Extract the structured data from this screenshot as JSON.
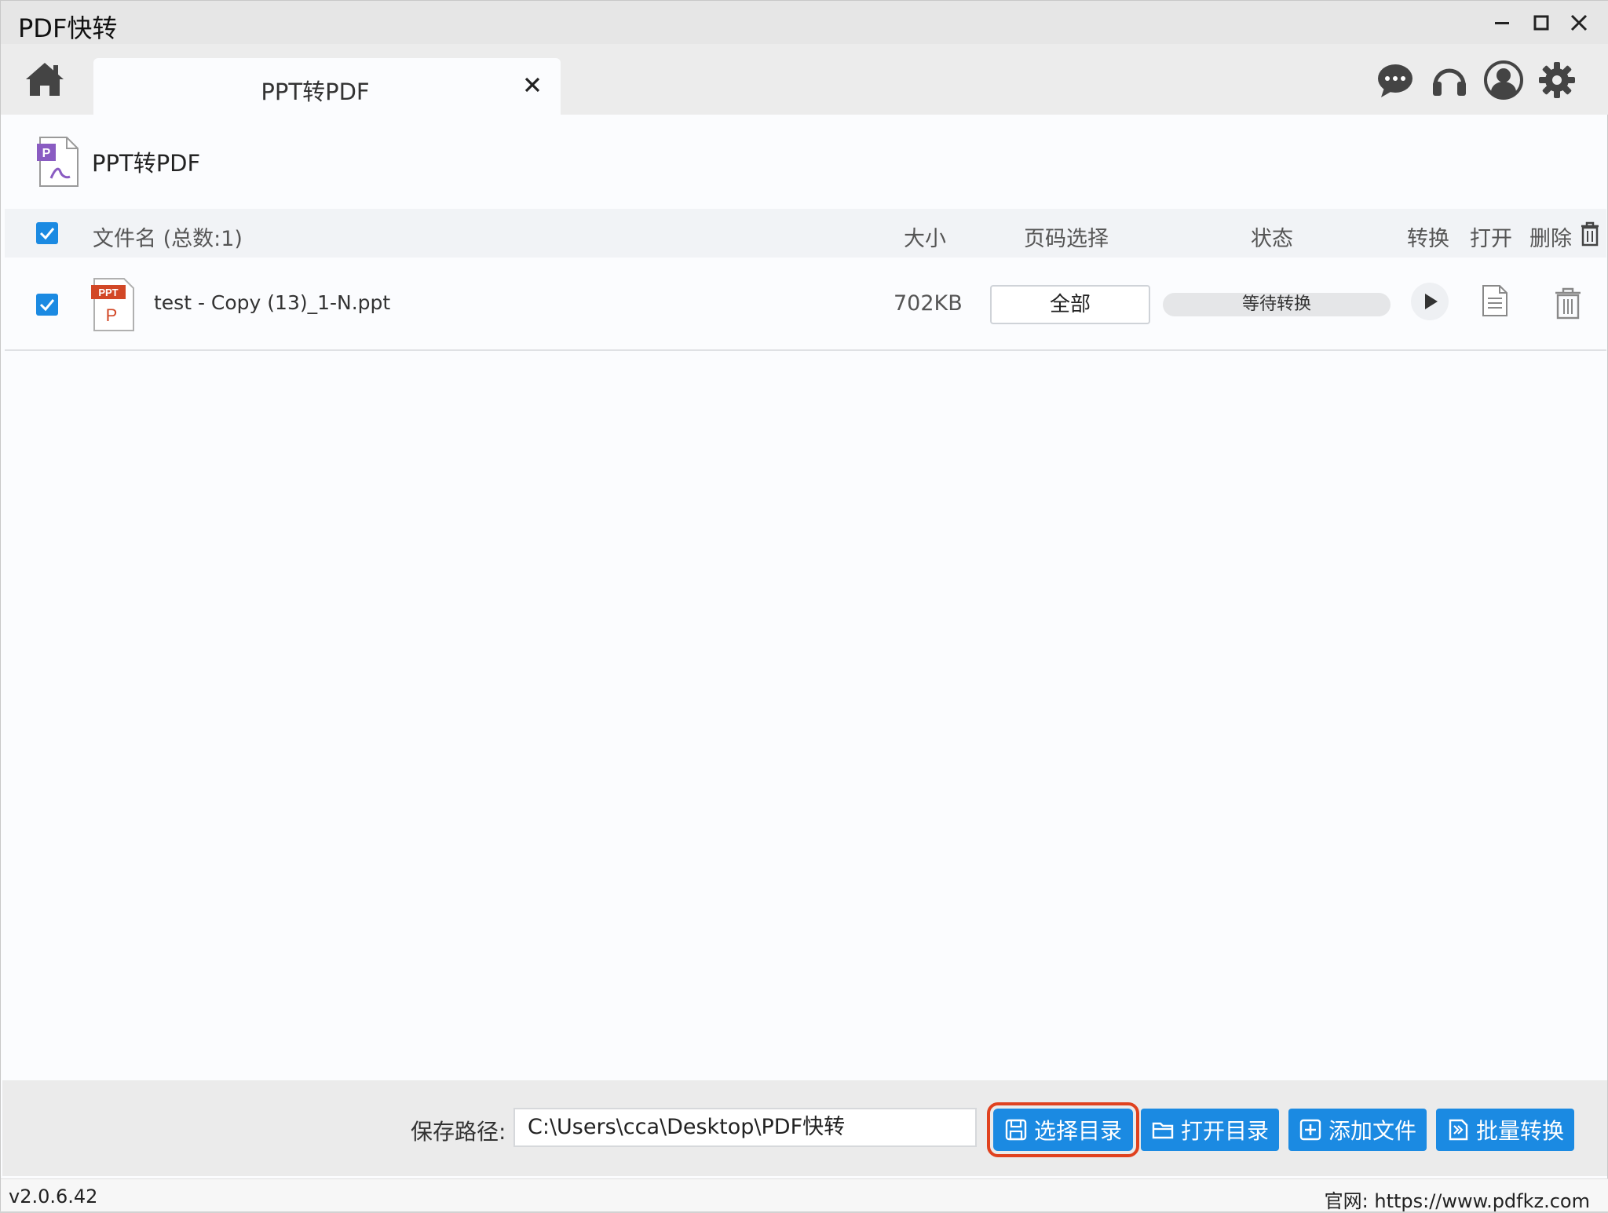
{
  "app": {
    "title": "PDF快转"
  },
  "window_controls": {
    "minimize": "—",
    "maximize": "☐",
    "close": "✕"
  },
  "tabs": [
    {
      "label": "PPT转PDF",
      "close": "✕"
    }
  ],
  "top_icons": [
    "chat-bubble-icon",
    "headset-icon",
    "user-avatar-icon",
    "gear-icon"
  ],
  "page": {
    "title": "PPT转PDF"
  },
  "table": {
    "headers": {
      "name": "文件名 (总数:1)",
      "size": "大小",
      "pages": "页码选择",
      "status": "状态",
      "convert": "转换",
      "open": "打开",
      "delete": "删除"
    },
    "select_all_checked": true,
    "rows": [
      {
        "checked": true,
        "file_name": "test - Copy (13)_1-N.ppt",
        "size": "702KB",
        "pages": "全部",
        "status": "等待转换",
        "file_badge": "PPT",
        "file_letter": "P"
      }
    ]
  },
  "bottom": {
    "save_label": "保存路径:",
    "save_path": "C:\\Users\\cca\\Desktop\\PDF快转",
    "buttons": {
      "choose_dir": "选择目录",
      "open_dir": "打开目录",
      "add_file": "添加文件",
      "batch_convert": "批量转换"
    }
  },
  "footer": {
    "version": "v2.0.6.42",
    "website": "官网: https://www.pdfkz.com"
  },
  "colors": {
    "accent": "#1b8ae2",
    "focus_outline": "#e0421f",
    "ppt_red": "#d24726",
    "pdf_purple": "#8a5cc2"
  }
}
